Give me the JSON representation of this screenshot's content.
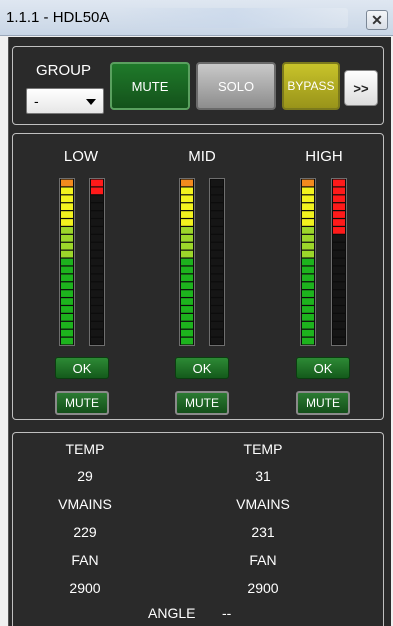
{
  "window": {
    "title": "1.1.1 - HDL50A",
    "close_label": "✕"
  },
  "controls": {
    "group_label": "GROUP",
    "group_value": "-",
    "mute_label": "MUTE",
    "solo_label": "SOLO",
    "bypass_label": "BYPASS",
    "more_label": ">>"
  },
  "bands": [
    {
      "label": "LOW",
      "level_segments": 21,
      "gr_segments": 2,
      "status": "OK",
      "mute_label": "MUTE"
    },
    {
      "label": "MID",
      "level_segments": 21,
      "gr_segments": 0,
      "status": "OK",
      "mute_label": "MUTE"
    },
    {
      "label": "HIGH",
      "level_segments": 21,
      "gr_segments": 7,
      "status": "OK",
      "mute_label": "MUTE"
    }
  ],
  "meter_total_segments": 21,
  "info": {
    "left": {
      "temp_label": "TEMP",
      "temp": "29",
      "vmains_label": "VMAINS",
      "vmains": "229",
      "fan_label": "FAN",
      "fan": "2900"
    },
    "right": {
      "temp_label": "TEMP",
      "temp": "31",
      "vmains_label": "VMAINS",
      "vmains": "231",
      "fan_label": "FAN",
      "fan": "2900"
    },
    "angle_label": "ANGLE",
    "angle_value": "--"
  },
  "colors": {
    "mute_active": "#1f7a2a",
    "solo": "#a9a9a9",
    "bypass": "#c8c32a",
    "level_green": "#1db31d",
    "level_yellow": "#f2f21e",
    "level_orange": "#f28a1e",
    "gr_red": "#ff1a1a"
  }
}
